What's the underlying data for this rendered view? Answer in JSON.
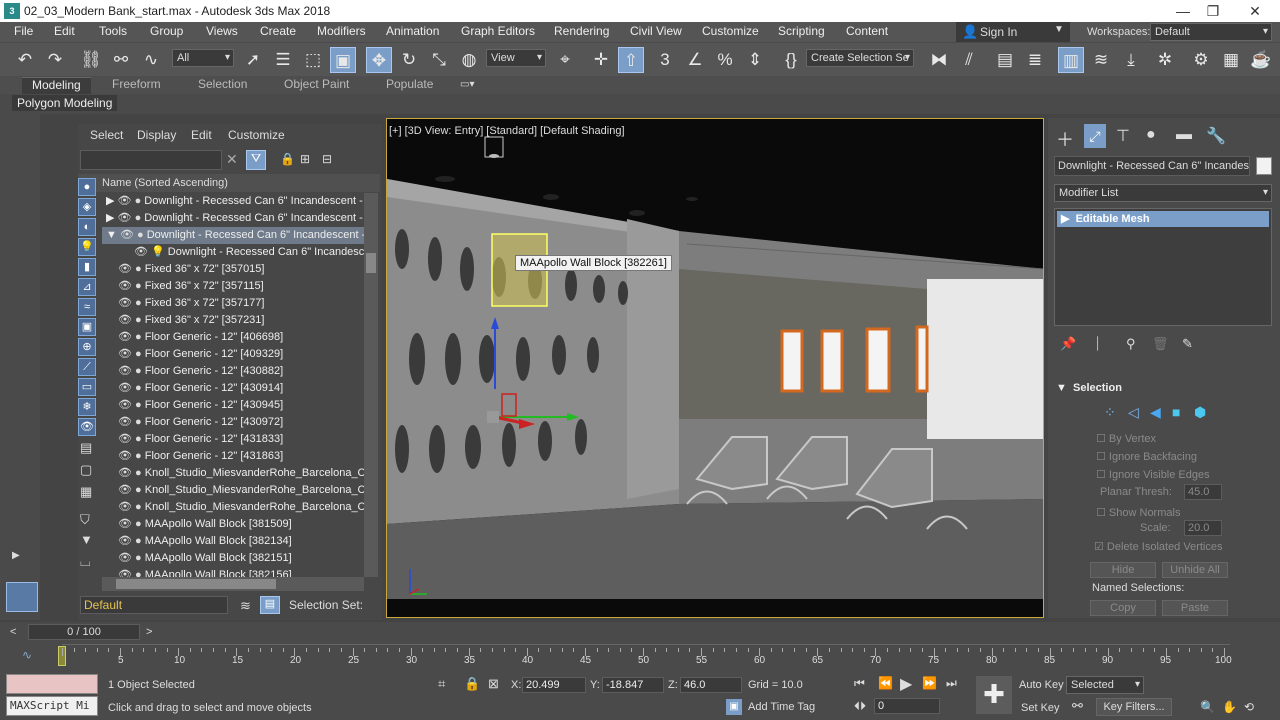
{
  "title": "02_03_Modern Bank_start.max - Autodesk 3ds Max 2018",
  "menu": [
    "File",
    "Edit",
    "Tools",
    "Group",
    "Views",
    "Create",
    "Modifiers",
    "Animation",
    "Graph Editors",
    "Rendering",
    "Civil View",
    "Customize",
    "Scripting",
    "Content"
  ],
  "signin": "Sign In",
  "workspaces_label": "Workspaces:",
  "workspace_value": "Default",
  "toolbar": {
    "filter": "All",
    "ref_coord": "View",
    "selset": "Create Selection Se"
  },
  "ribbon_tabs": [
    "Modeling",
    "Freeform",
    "Selection",
    "Object Paint",
    "Populate"
  ],
  "ribbon_sub": "Polygon Modeling",
  "explorer_menu": [
    "Select",
    "Display",
    "Edit",
    "Customize"
  ],
  "column_header": "Name (Sorted Ascending)",
  "rows": [
    "Downlight - Recessed Can 6\" Incandescent - 12",
    "Downlight - Recessed Can 6\" Incandescent - 12",
    "Downlight - Recessed Can 6\" Incandescent - 12",
    "Downlight - Recessed Can 6\" Incandescent",
    "Fixed 36\" x 72\" [357015]",
    "Fixed 36\" x 72\" [357115]",
    "Fixed 36\" x 72\" [357177]",
    "Fixed 36\" x 72\" [357231]",
    "Floor Generic - 12\" [406698]",
    "Floor Generic - 12\" [409329]",
    "Floor Generic - 12\" [430882]",
    "Floor Generic - 12\" [430914]",
    "Floor Generic - 12\" [430945]",
    "Floor Generic - 12\" [430972]",
    "Floor Generic - 12\" [431833]",
    "Floor Generic - 12\" [431863]",
    "Knoll_Studio_MiesvanderRohe_Barcelona_Chair",
    "Knoll_Studio_MiesvanderRohe_Barcelona_Chair",
    "Knoll_Studio_MiesvanderRohe_Barcelona_Chair",
    "MAApollo Wall Block [381509]",
    "MAApollo Wall Block [382134]",
    "MAApollo Wall Block [382151]",
    "MAApollo Wall Block [382156]"
  ],
  "layer": "Default",
  "selection_set_label": "Selection Set:",
  "viewport_label": "[+] [3D View: Entry] [Standard] [Default Shading]",
  "tooltip": "MAApollo Wall Block [382261]",
  "cmd": {
    "object_name": "Downlight - Recessed Can 6\" Incandescent",
    "modifier_list": "Modifier List",
    "modifier": "Editable Mesh",
    "rollout": "Selection",
    "by_vertex": "By Vertex",
    "ignore_backfacing": "Ignore Backfacing",
    "ignore_visible_edges": "Ignore Visible Edges",
    "planar_thresh_label": "Planar Thresh:",
    "planar_thresh": "45.0",
    "show_normals": "Show Normals",
    "scale_label": "Scale:",
    "scale": "20.0",
    "delete_isolated": "Delete Isolated Vertices",
    "hide": "Hide",
    "unhide_all": "Unhide All",
    "named_selections": "Named Selections:",
    "copy": "Copy",
    "paste": "Paste"
  },
  "timeline": {
    "frame": "0 / 100",
    "ticks": [
      "5",
      "10",
      "15",
      "20",
      "25",
      "30",
      "35",
      "40",
      "45",
      "50",
      "55",
      "60",
      "65",
      "70",
      "75",
      "80",
      "85",
      "90",
      "95",
      "100"
    ]
  },
  "status": {
    "maxscript": "MAXScript Mi",
    "selected": "1 Object Selected",
    "prompt": "Click and drag to select and move objects",
    "x_label": "X:",
    "x": "20.499",
    "y_label": "Y:",
    "y": "-18.847",
    "z_label": "Z:",
    "z": "46.0",
    "grid": "Grid = 10.0",
    "add_time_tag": "Add Time Tag",
    "auto_key": "Auto Key",
    "set_key": "Set Key",
    "key_mode": "Selected",
    "key_filters": "Key Filters...",
    "frame_field": "0"
  },
  "colors": {
    "accent": "#7a9ec8",
    "selection": "#6f7b8a",
    "viewport_border": "#c9a73a"
  }
}
